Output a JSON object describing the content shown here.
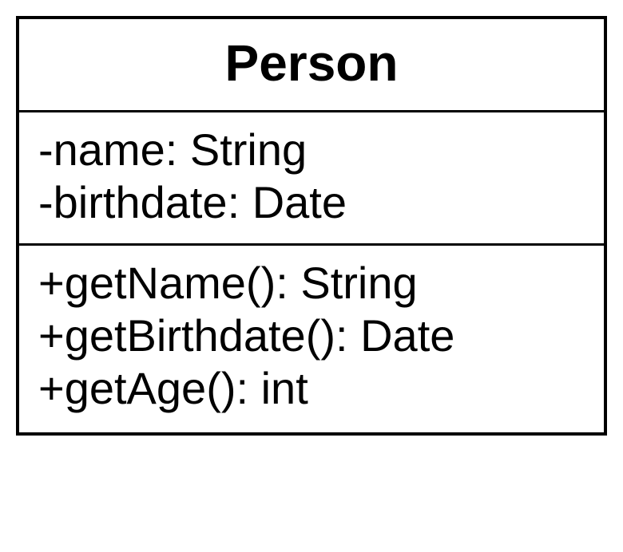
{
  "class": {
    "name": "Person",
    "attributes": [
      "-name: String",
      "-birthdate: Date"
    ],
    "methods": [
      "+getName(): String",
      "+getBirthdate(): Date",
      "+getAge(): int"
    ]
  }
}
